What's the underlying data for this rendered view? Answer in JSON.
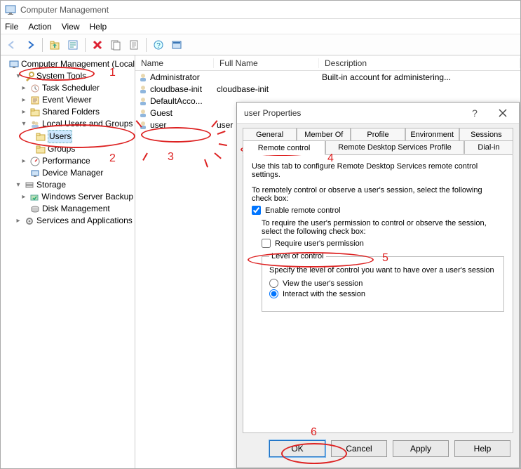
{
  "title": "Computer Management",
  "menubar": [
    "File",
    "Action",
    "View",
    "Help"
  ],
  "toolbar_enabled": [
    false,
    true,
    true,
    true,
    true,
    true,
    true,
    true,
    true,
    true
  ],
  "tree": {
    "root": "Computer Management (Local",
    "system_tools": "System Tools",
    "task_scheduler": "Task Scheduler",
    "event_viewer": "Event Viewer",
    "shared_folders": "Shared Folders",
    "local_users": "Local Users and Groups",
    "users": "Users",
    "groups": "Groups",
    "performance": "Performance",
    "device_manager": "Device Manager",
    "storage": "Storage",
    "wsb": "Windows Server Backup",
    "disk_mgmt": "Disk Management",
    "services": "Services and Applications"
  },
  "list": {
    "headers": {
      "name": "Name",
      "full": "Full Name",
      "desc": "Description"
    },
    "rows": [
      {
        "name": "Administrator",
        "full": "",
        "desc": "Built-in account for administering..."
      },
      {
        "name": "cloudbase-init",
        "full": "cloudbase-init",
        "desc": ""
      },
      {
        "name": "DefaultAcco...",
        "full": "",
        "desc": ""
      },
      {
        "name": "Guest",
        "full": "",
        "desc": ""
      },
      {
        "name": "user",
        "full": "user",
        "desc": ""
      }
    ]
  },
  "dialog": {
    "title": "user Properties",
    "tabs_top": [
      "General",
      "Member Of",
      "Profile",
      "Environment",
      "Sessions"
    ],
    "tabs_bot": [
      "Remote control",
      "Remote Desktop Services Profile",
      "Dial-in"
    ],
    "desc": "Use this tab to configure Remote Desktop Services remote control settings.",
    "remote_text": "To remotely control or observe a user's session, select the following check box:",
    "enable_label": "Enable remote control",
    "perm_text": "To require the user's permission to control or observe the session, select the following check box:",
    "require_label": "Require user's permission",
    "fieldset": "Level of control",
    "fieldset_desc": "Specify the level of control you want to have over a user's session",
    "radio_view": "View the user's session",
    "radio_interact": "Interact with the session",
    "buttons": {
      "ok": "OK",
      "cancel": "Cancel",
      "apply": "Apply",
      "help": "Help"
    }
  },
  "annotations": {
    "n1": "1",
    "n2": "2",
    "n3": "3",
    "n4": "4",
    "n5": "5",
    "n6": "6"
  }
}
